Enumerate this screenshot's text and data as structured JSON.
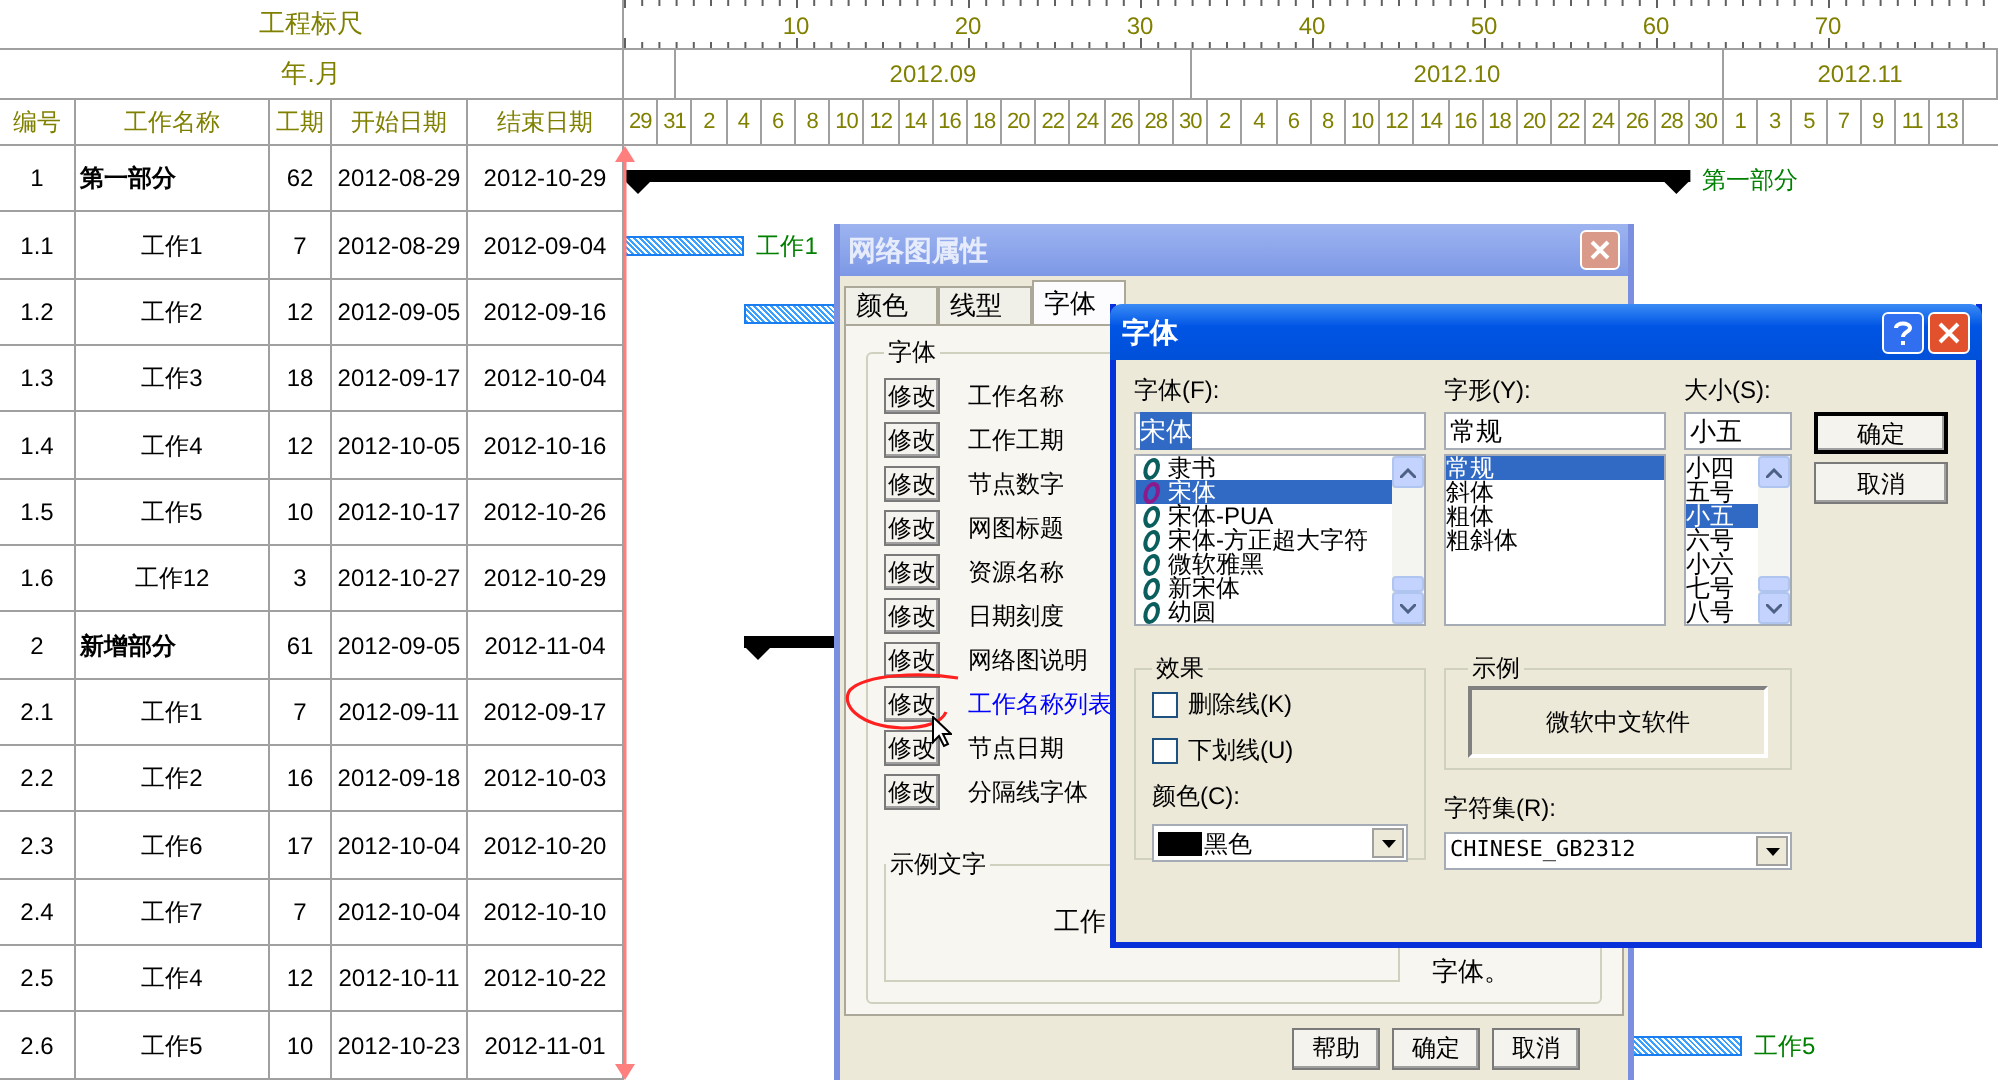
{
  "table": {
    "ruler_title": "工程标尺",
    "month_title": "年.月",
    "columns": [
      "编号",
      "工作名称",
      "工期",
      "开始日期",
      "结束日期"
    ],
    "rows": [
      {
        "id": "1",
        "name": "第一部分",
        "duration": "62",
        "start": "2012-08-29",
        "end": "2012-10-29",
        "kind": "summary",
        "bar": {
          "kind": "summary",
          "label": "第一部分"
        }
      },
      {
        "id": "1.1",
        "name": "工作1",
        "duration": "7",
        "start": "2012-08-29",
        "end": "2012-09-04",
        "kind": "task",
        "bar": {
          "kind": "task",
          "label": "工作1"
        }
      },
      {
        "id": "1.2",
        "name": "工作2",
        "duration": "12",
        "start": "2012-09-05",
        "end": "2012-09-16",
        "kind": "task",
        "bar": {
          "kind": "task"
        }
      },
      {
        "id": "1.3",
        "name": "工作3",
        "duration": "18",
        "start": "2012-09-17",
        "end": "2012-10-04",
        "kind": "task"
      },
      {
        "id": "1.4",
        "name": "工作4",
        "duration": "12",
        "start": "2012-10-05",
        "end": "2012-10-16",
        "kind": "task"
      },
      {
        "id": "1.5",
        "name": "工作5",
        "duration": "10",
        "start": "2012-10-17",
        "end": "2012-10-26",
        "kind": "task"
      },
      {
        "id": "1.6",
        "name": "工作12",
        "duration": "3",
        "start": "2012-10-27",
        "end": "2012-10-29",
        "kind": "task"
      },
      {
        "id": "2",
        "name": "新增部分",
        "duration": "61",
        "start": "2012-09-05",
        "end": "2012-11-04",
        "kind": "summary",
        "bar": {
          "kind": "summary"
        }
      },
      {
        "id": "2.1",
        "name": "工作1",
        "duration": "7",
        "start": "2012-09-11",
        "end": "2012-09-17",
        "kind": "task"
      },
      {
        "id": "2.2",
        "name": "工作2",
        "duration": "16",
        "start": "2012-09-18",
        "end": "2012-10-03",
        "kind": "task"
      },
      {
        "id": "2.3",
        "name": "工作6",
        "duration": "17",
        "start": "2012-10-04",
        "end": "2012-10-20",
        "kind": "task"
      },
      {
        "id": "2.4",
        "name": "工作7",
        "duration": "7",
        "start": "2012-10-04",
        "end": "2012-10-10",
        "kind": "task"
      },
      {
        "id": "2.5",
        "name": "工作4",
        "duration": "12",
        "start": "2012-10-11",
        "end": "2012-10-22",
        "kind": "task"
      },
      {
        "id": "2.6",
        "name": "工作5",
        "duration": "10",
        "start": "2012-10-23",
        "end": "2012-11-01",
        "kind": "task",
        "bar": {
          "kind": "task",
          "label": "工作5"
        }
      }
    ]
  },
  "timescale": {
    "ruler_labels": [
      "10",
      "20",
      "30",
      "40",
      "50",
      "60",
      "70"
    ],
    "months": [
      "2012.09",
      "2012.10",
      "2012.11"
    ],
    "days": [
      "29",
      "31",
      "2",
      "4",
      "6",
      "8",
      "10",
      "12",
      "14",
      "16",
      "18",
      "20",
      "22",
      "24",
      "26",
      "28",
      "30",
      "2",
      "4",
      "6",
      "8",
      "10",
      "12",
      "14",
      "16",
      "18",
      "20",
      "22",
      "24",
      "26",
      "28",
      "30",
      "1",
      "3",
      "5",
      "7",
      "9",
      "11",
      "13"
    ]
  },
  "properties_dialog": {
    "title": "网络图属性",
    "tabs": [
      {
        "label": "颜色",
        "selected": false
      },
      {
        "label": "线型",
        "selected": false
      },
      {
        "label": "字体",
        "selected": true
      }
    ],
    "group_title": "字体",
    "font_items": [
      {
        "button": "修改",
        "label": "工作名称",
        "highlighted": false
      },
      {
        "button": "修改",
        "label": "工作工期",
        "highlighted": false
      },
      {
        "button": "修改",
        "label": "节点数字",
        "highlighted": false
      },
      {
        "button": "修改",
        "label": "网图标题",
        "highlighted": false
      },
      {
        "button": "修改",
        "label": "资源名称",
        "highlighted": false
      },
      {
        "button": "修改",
        "label": "日期刻度",
        "highlighted": false
      },
      {
        "button": "修改",
        "label": "网络图说明",
        "highlighted": false
      },
      {
        "button": "修改",
        "label": "工作名称列表",
        "highlighted": true
      },
      {
        "button": "修改",
        "label": "节点日期",
        "highlighted": false
      },
      {
        "button": "修改",
        "label": "分隔线字体",
        "highlighted": false
      }
    ],
    "sample_group_title": "示例文字",
    "sample_text": "工作",
    "sample_text_tail": "字体。",
    "buttons": [
      "帮助",
      "确定",
      "取消"
    ]
  },
  "font_dialog": {
    "title": "字体",
    "font": {
      "label": "字体(F):",
      "value": "宋体",
      "items": [
        {
          "label": "隶书",
          "selected": false
        },
        {
          "label": "宋体",
          "selected": true
        },
        {
          "label": "宋体-PUA",
          "selected": false
        },
        {
          "label": "宋体-方正超大字符",
          "selected": false
        },
        {
          "label": "微软雅黑",
          "selected": false
        },
        {
          "label": "新宋体",
          "selected": false
        },
        {
          "label": "幼圆",
          "selected": false
        }
      ]
    },
    "style": {
      "label": "字形(Y):",
      "value": "常规",
      "items": [
        {
          "label": "常规",
          "selected": true
        },
        {
          "label": "斜体",
          "selected": false
        },
        {
          "label": "粗体",
          "selected": false
        },
        {
          "label": "粗斜体",
          "selected": false
        }
      ]
    },
    "size": {
      "label": "大小(S):",
      "value": "小五",
      "items": [
        {
          "label": "小四",
          "selected": false
        },
        {
          "label": "五号",
          "selected": false
        },
        {
          "label": "小五",
          "selected": true
        },
        {
          "label": "六号",
          "selected": false
        },
        {
          "label": "小六",
          "selected": false
        },
        {
          "label": "七号",
          "selected": false
        },
        {
          "label": "八号",
          "selected": false
        }
      ]
    },
    "buttons": [
      "确定",
      "取消"
    ],
    "effects": {
      "title": "效果",
      "options": [
        {
          "label": "删除线(K)",
          "checked": false
        },
        {
          "label": "下划线(U)",
          "checked": false
        }
      ],
      "color_label": "颜色(C):",
      "color": {
        "label": "黑色",
        "color": "#000000"
      }
    },
    "sample": {
      "title": "示例",
      "text": "微软中文软件"
    },
    "charset": {
      "label": "字符集(R):",
      "value": "CHINESE_GB2312"
    }
  }
}
